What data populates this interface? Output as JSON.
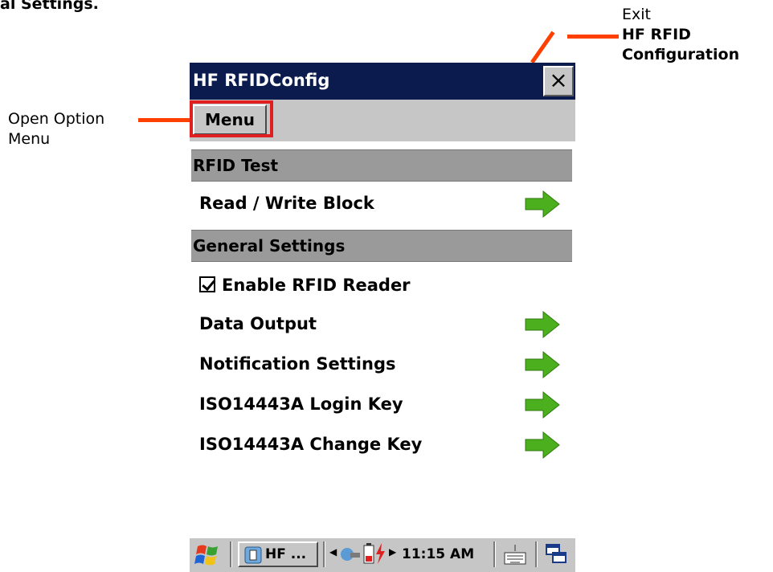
{
  "doc_fragment": "al Settings.",
  "callouts": {
    "exit_prefix": "Exit",
    "exit_bold": "HF RFID Configuration",
    "menu": "Open Option Menu"
  },
  "window": {
    "title": "HF RFIDConfig",
    "close_glyph": "×",
    "menu_label": "Menu"
  },
  "sections": [
    {
      "header": "RFID Test",
      "items": [
        "Read / Write Block"
      ]
    },
    {
      "header": "General Settings"
    }
  ],
  "settings": {
    "enable_label": "Enable RFID Reader",
    "enable_checked": true,
    "items": [
      "Data Output",
      "Notification Settings",
      "ISO14443A Login Key",
      "ISO14443A Change Key"
    ]
  },
  "taskbar": {
    "app_label": "HF ...",
    "time": "11:15 AM"
  },
  "colors": {
    "titlebar": "#0b1b4d",
    "callout_line": "#ff4000",
    "arrow_green": "#4caf1e"
  },
  "icons": {
    "start": "windows-flag-icon",
    "arrow": "green-arrow-icon",
    "keyboard": "keyboard-icon",
    "desktop": "window-switch-icon"
  }
}
